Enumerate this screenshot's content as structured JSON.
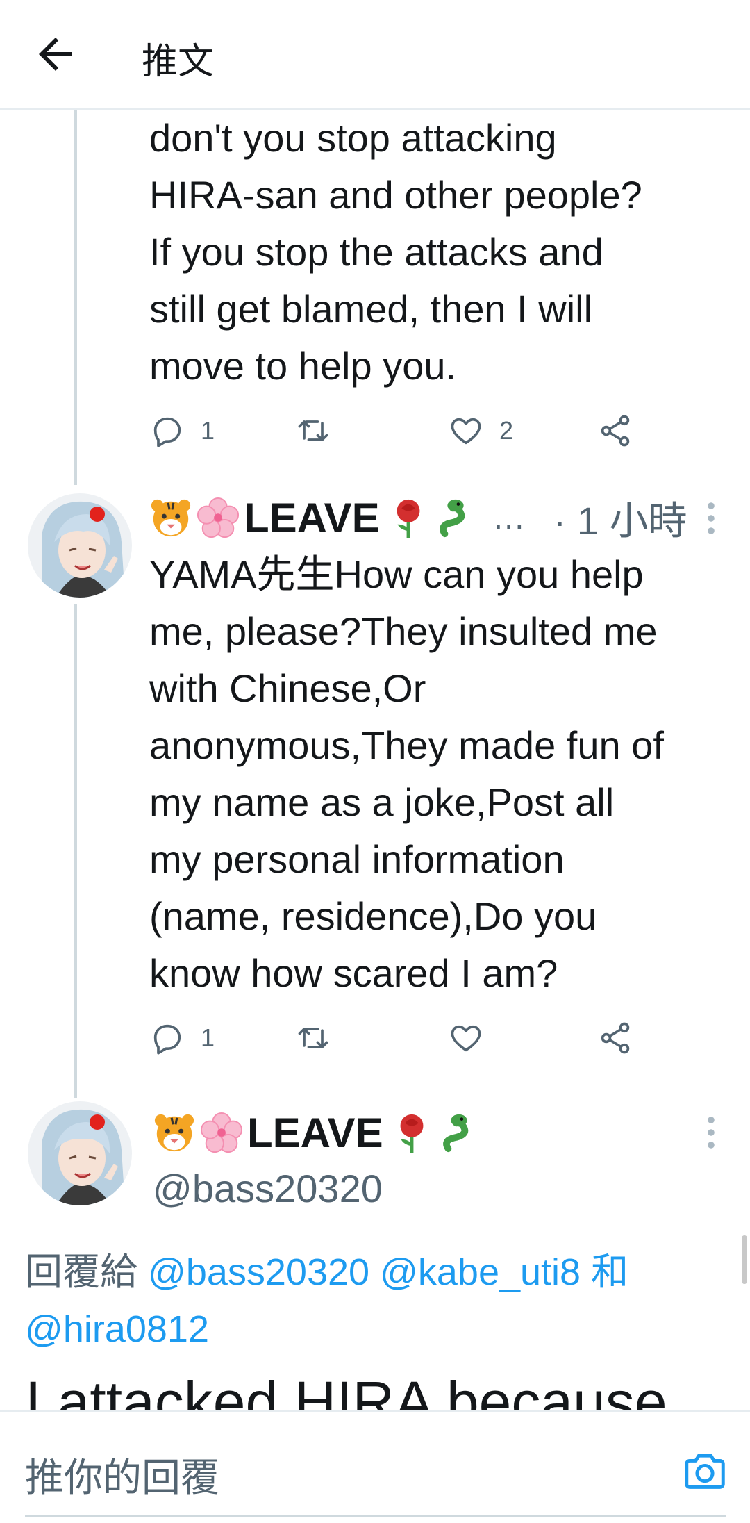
{
  "header": {
    "title": "推文"
  },
  "tweets": [
    {
      "text_lines": [
        "don't you stop attacking",
        "HIRA-san and other people?",
        "If you stop the attacks and",
        "still get blamed, then I will",
        "move to help you."
      ],
      "actions": {
        "reply_count": "1",
        "retweet_count": "",
        "like_count": "2"
      }
    },
    {
      "display_name": "LEAVE",
      "name_ellipsis": "…",
      "time": "· 1 小時",
      "text_lines": [
        "YAMA先生How can you help",
        "me, please?They insulted me",
        "with Chinese,Or",
        "anonymous,They made fun of",
        "my name as a joke,Post all",
        "my personal information",
        "(name, residence),Do you",
        "know how scared I am?"
      ],
      "actions": {
        "reply_count": "1",
        "retweet_count": "",
        "like_count": ""
      }
    }
  ],
  "main_tweet": {
    "display_name": "LEAVE",
    "handle": "@bass20320",
    "reply_prefix": "回覆給",
    "reply_user_1": "@bass20320",
    "reply_user_2": "@kabe_uti8",
    "reply_and": "和",
    "reply_user_3": "@hira0812",
    "text": "I attacked HIRA because"
  },
  "composer": {
    "placeholder": "推你的回覆"
  },
  "icons": {
    "back": "arrow-left-icon",
    "reply": "speech-bubble-icon",
    "retweet": "retweet-icon",
    "like": "heart-icon",
    "share": "share-icon",
    "more": "vertical-dots-icon",
    "camera": "camera-icon"
  },
  "colors": {
    "link": "#1d9bf0",
    "muted": "#536471"
  }
}
